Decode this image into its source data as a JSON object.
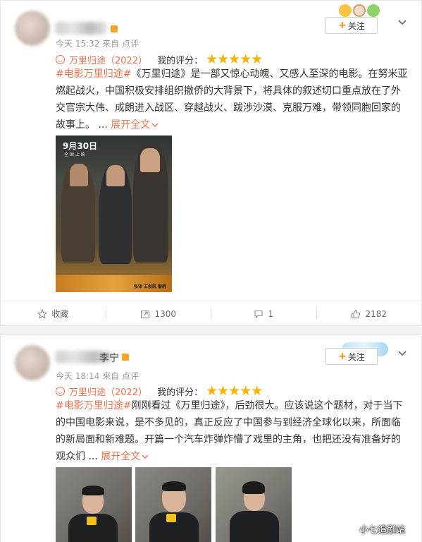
{
  "posts": [
    {
      "time": "今天 15:32",
      "source": "来自 点评",
      "follow_label": "关注",
      "movie_title": "万里归途（2022）",
      "rating_label": "我的评分：",
      "stars": "★★★★★",
      "rating_value": 5,
      "hashtag": "#电影万里归途#",
      "text": "《万里归途》是一部又惊心动魄、又感人至深的电影。在努米亚燃起战火，中国积极安排组织撤侨的大背景下，将具体的叙述切口重点放在了外交官宗大伟、成朗进入战区、穿越战火、跋涉沙漠、克服万难，带领同胞回家的故事上。 ...",
      "expand_label": "展开全文",
      "poster": {
        "date": "9月30日",
        "sub": "全 国 上 映",
        "credits": "张译   王俊凯   殷桃"
      },
      "actions": {
        "favorite": "收藏",
        "repost": "1300",
        "comment": "1",
        "like": "2182"
      }
    },
    {
      "username_partial": "李宁",
      "time": "今天 18:14",
      "source": "来自 点评",
      "follow_label": "关注",
      "movie_title": "万里归途（2022）",
      "rating_label": "我的评分：",
      "stars": "★★★★★",
      "rating_value": 5,
      "hashtag": "#电影万里归途#",
      "text": "刚刚看过《万里归途》，后劲很大。应该说这个题材，对于当下的中国电影来说，是不多见的，真正反应了中国参与到经济全球化以来，所面临的新局面和新难题。开篇一个汽车炸弹炸懵了戏里的主角，也把还没有准备好的观众们 ...",
      "expand_label": "展开全文"
    }
  ],
  "watermark": "小七追剧站",
  "colors": {
    "accent": "#eb7350",
    "follow_plus": "#ff8200",
    "star": "#f5b400"
  }
}
